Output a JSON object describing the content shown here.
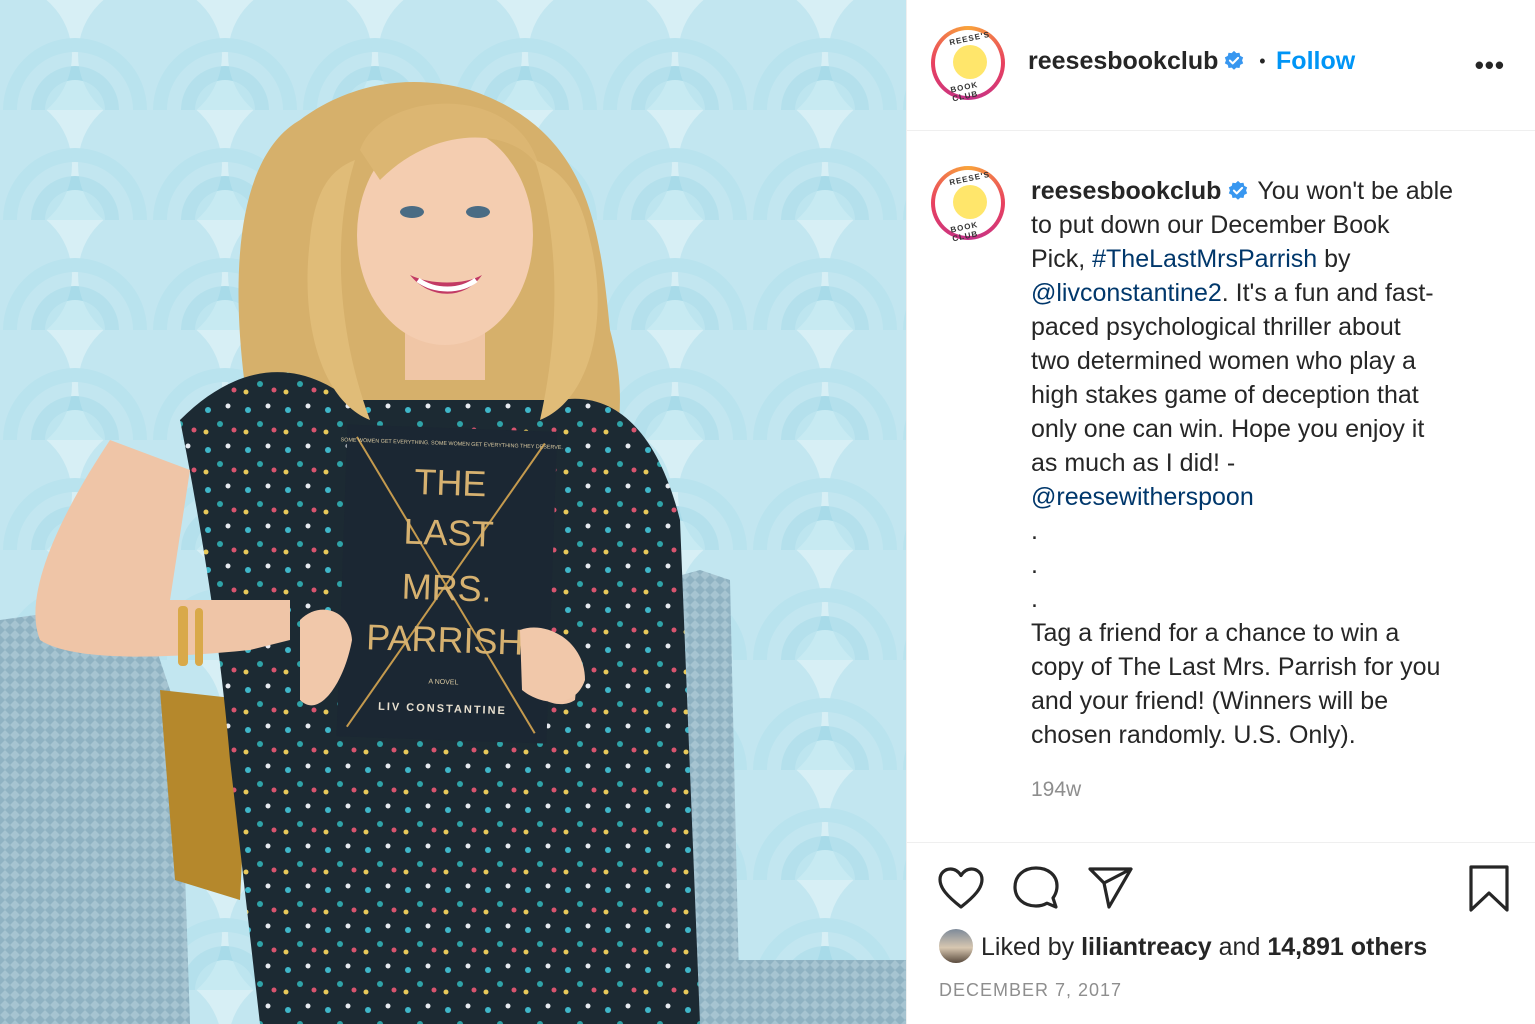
{
  "photo": {
    "book_tagline": "SOME WOMEN GET EVERYTHING. SOME WOMEN GET EVERYTHING THEY DESERVE.",
    "book_title_lines": [
      "THE",
      "LAST",
      "MRS.",
      "PARRISH"
    ],
    "book_subtitle": "A NOVEL",
    "book_author": "LIV CONSTANTINE"
  },
  "header": {
    "avatar_text_top": "REESE'S",
    "avatar_text_bottom": "BOOK CLUB",
    "username": "reesesbookclub",
    "separator": "•",
    "follow_label": "Follow",
    "more_label": "•••"
  },
  "caption": {
    "username": "reesesbookclub",
    "lines": [
      "You won't be able",
      "to put down our December Book",
      "Pick, ",
      " by",
      ". It's a fun and fast-",
      "paced psychological thriller about",
      "two determined women who play a",
      "high stakes game of deception that",
      "only one can win. Hope you enjoy it",
      "as much as I did! -",
      ".",
      ".",
      ".",
      "Tag a friend for a chance to win a",
      "copy of The Last Mrs. Parrish for you",
      "and your friend! (Winners will be",
      "chosen randomly. U.S. Only)."
    ],
    "hashtag": "#TheLastMrsParrish",
    "mention_author": "@livconstantine2",
    "mention_signoff": "@reesewitherspoon",
    "time_ago": "194w"
  },
  "actions": {
    "icons": [
      "heart-icon",
      "comment-icon",
      "share-icon",
      "bookmark-icon"
    ],
    "liked_prefix": "Liked by ",
    "liked_user": "liliantreacy",
    "liked_middle": " and ",
    "liked_count": "14,891 others",
    "date": "DECEMBER 7, 2017"
  },
  "colors": {
    "follow": "#0095f6",
    "link": "#00376b",
    "muted": "#8e8e8e",
    "verified": "#3897f0"
  }
}
